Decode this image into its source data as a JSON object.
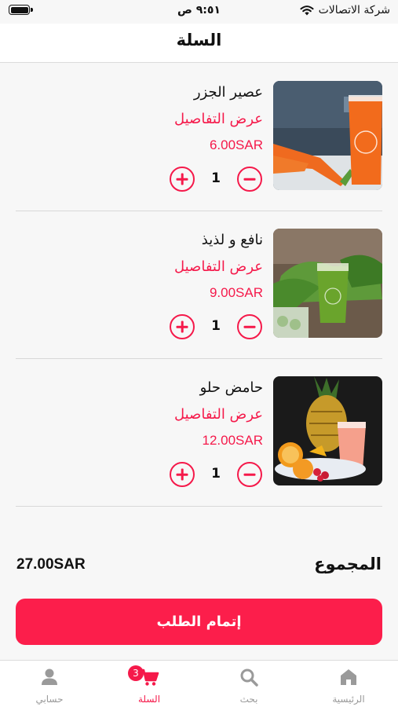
{
  "status_bar": {
    "time": "٩:٥١ ص",
    "carrier": "شركة الاتصالات"
  },
  "header": {
    "title": "السلة"
  },
  "cart": {
    "items": [
      {
        "name": "عصير الجزر",
        "details_label": "عرض التفاصيل",
        "price": "6.00SAR",
        "quantity": "1"
      },
      {
        "name": "نافع و لذيذ",
        "details_label": "عرض التفاصيل",
        "price": "9.00SAR",
        "quantity": "1"
      },
      {
        "name": "حامض حلو",
        "details_label": "عرض التفاصيل",
        "price": "12.00SAR",
        "quantity": "1"
      }
    ]
  },
  "summary": {
    "total_label": "المجموع",
    "total_value": "27.00SAR"
  },
  "checkout": {
    "label": "إتمام الطلب"
  },
  "tab_bar": {
    "tabs": [
      {
        "label": "الرئيسية",
        "icon": "home-icon"
      },
      {
        "label": "بحث",
        "icon": "search-icon"
      },
      {
        "label": "السلة",
        "icon": "cart-icon",
        "badge": "3",
        "active": true
      },
      {
        "label": "حسابي",
        "icon": "person-icon"
      }
    ]
  },
  "colors": {
    "accent": "#f5194a",
    "button": "#fc1e4b",
    "inactive": "#999999"
  }
}
